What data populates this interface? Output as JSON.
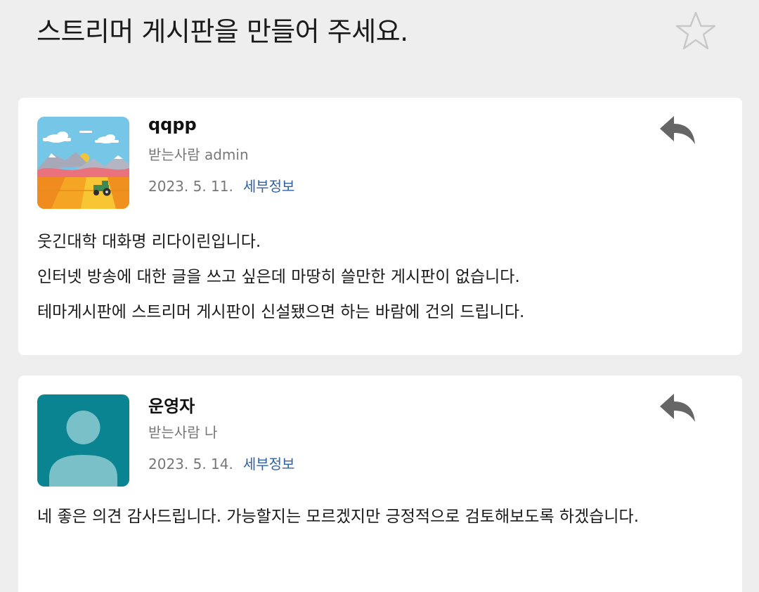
{
  "header": {
    "title": "스트리머 게시판을 만들어 주세요."
  },
  "messages": [
    {
      "sender": "qqpp",
      "recipient": "받는사람 admin",
      "date": "2023. 5. 11.",
      "details_label": "세부정보",
      "avatar_icon": "landscape-avatar-icon",
      "body": [
        "웃긴대학 대화명 리다이린입니다.",
        "인터넷 방송에 대한 글을 쓰고 싶은데 마땅히 쓸만한 게시판이 없습니다.",
        "테마게시판에 스트리머 게시판이 신설됐으면 하는 바람에 건의 드립니다."
      ]
    },
    {
      "sender": "운영자",
      "recipient": "받는사람 나",
      "date": "2023. 5. 14.",
      "details_label": "세부정보",
      "avatar_icon": "default-user-avatar-icon",
      "body": [
        "네 좋은 의견 감사드립니다. 가능할지는 모르겠지만 긍정적으로 검토해보도록 하겠습니다."
      ]
    }
  ],
  "colors": {
    "background": "#eeeeee",
    "card": "#ffffff",
    "link": "#2f62a8",
    "muted_text": "#777777",
    "avatar_teal": "#0b8491",
    "icon_gray": "#666666"
  }
}
